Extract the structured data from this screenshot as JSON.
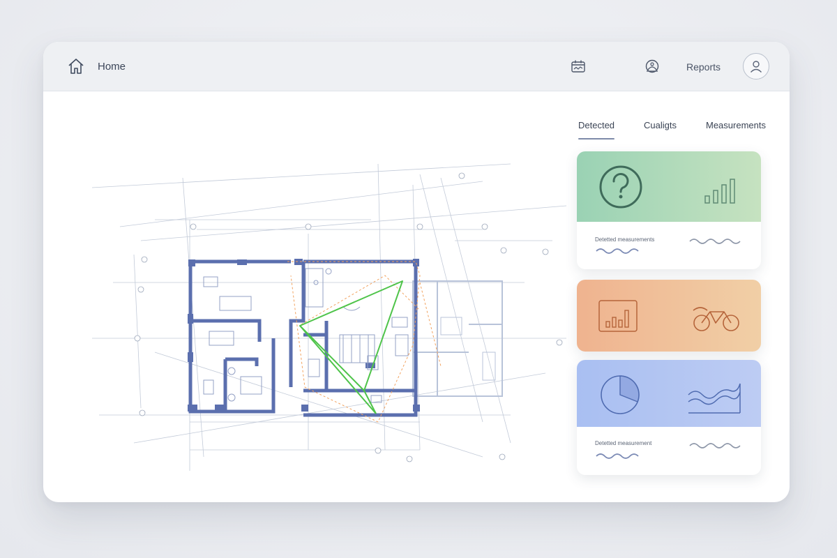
{
  "topbar": {
    "home_label": "Home",
    "reports_label": "Reports",
    "icons": [
      "home-icon",
      "calendar-icon",
      "alert-icon",
      "user-icon"
    ]
  },
  "tabs": [
    {
      "label": "Detected",
      "active": true
    },
    {
      "label": "Cualigts",
      "active": false
    },
    {
      "label": "Measurements",
      "active": false
    }
  ],
  "cards": {
    "green": {
      "icons": [
        "question-icon",
        "bar-chart-icon"
      ],
      "detail_label": "Detetted measurements",
      "colors": [
        "#9ad2b4",
        "#c6e2c0"
      ]
    },
    "orange": {
      "icons": [
        "bar-chart-box-icon",
        "bicycle-icon"
      ],
      "colors": [
        "#efb38f",
        "#f1cfa6"
      ]
    },
    "blue": {
      "icons": [
        "pie-chart-icon",
        "wave-chart-icon"
      ],
      "detail_label": "Detetted measurement",
      "colors": [
        "#a9bff2",
        "#bdccf3"
      ]
    }
  },
  "plan": {
    "description_icon": "floor-plan",
    "accent_overlay": "#4fc44a",
    "wall_color": "#5b6fae",
    "dashed_overlay": "#f2a25e"
  }
}
